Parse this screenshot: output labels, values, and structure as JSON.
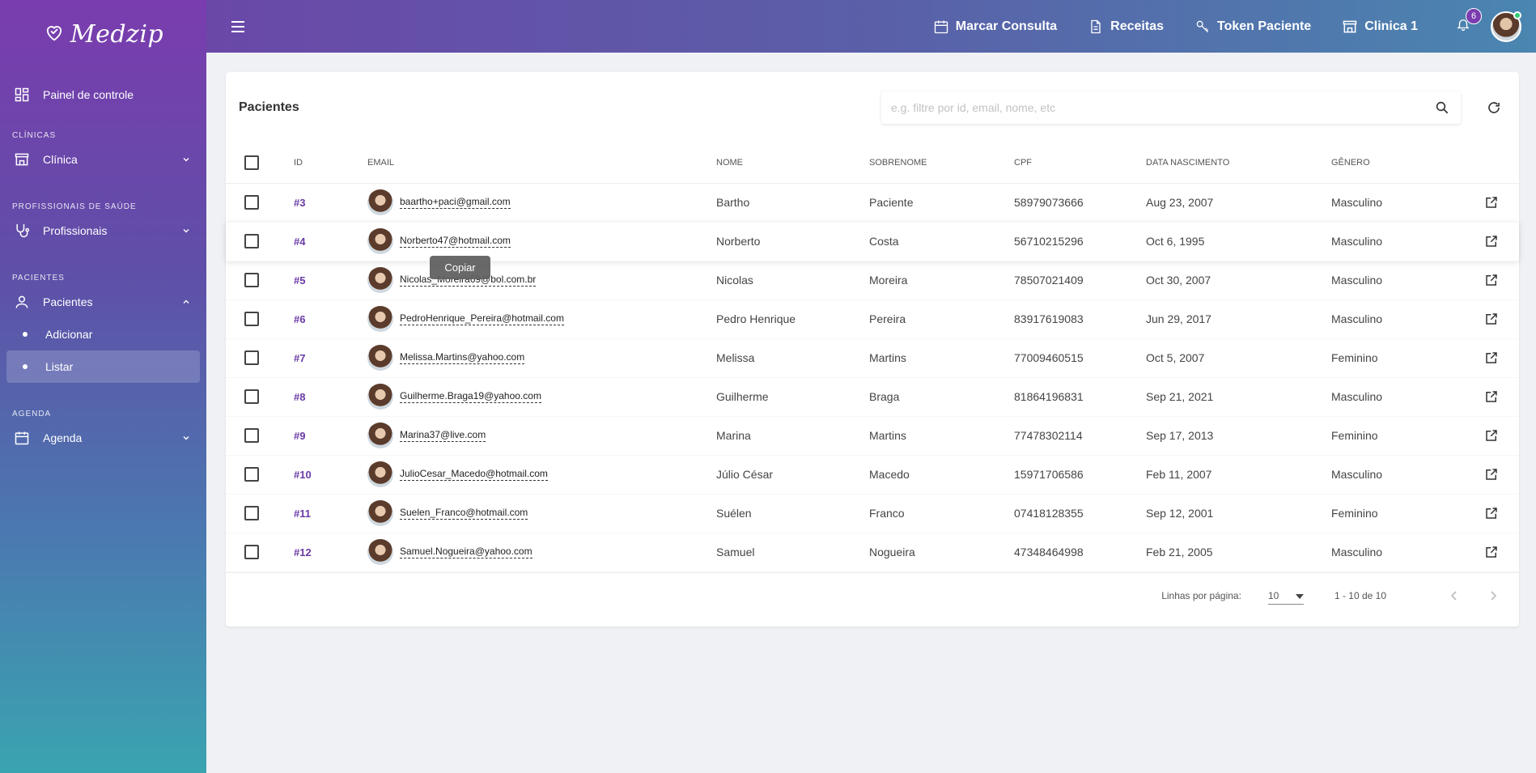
{
  "brand": {
    "name": "Medzip"
  },
  "sidebar": {
    "dashboard": "Painel de controle",
    "sections": {
      "clinicas": "CLÍNICAS",
      "profissionais": "PROFISSIONAIS DE SAÚDE",
      "pacientes": "PACIENTES",
      "agenda": "AGENDA"
    },
    "clinica": "Clínica",
    "profissionais": "Profissionais",
    "pacientes": "Pacientes",
    "pacientes_sub": {
      "adicionar": "Adicionar",
      "listar": "Listar"
    },
    "agenda": "Agenda"
  },
  "topbar": {
    "marcar_consulta": "Marcar Consulta",
    "receitas": "Receitas",
    "token_paciente": "Token Paciente",
    "clinica": "Clinica 1",
    "notifications": "6"
  },
  "page": {
    "title": "Pacientes",
    "search_placeholder": "e.g. filtre por id, email, nome, etc",
    "tooltip": "Copiar"
  },
  "table": {
    "headers": {
      "id": "ID",
      "email": "EMAIL",
      "nome": "NOME",
      "sobrenome": "SOBRENOME",
      "cpf": "CPF",
      "nascimento": "DATA NASCIMENTO",
      "genero": "GÊNERO"
    },
    "rows": [
      {
        "id": "#3",
        "email": "baartho+paci@gmail.com",
        "nome": "Bartho",
        "sobrenome": "Paciente",
        "cpf": "58979073666",
        "nascimento": "Aug 23, 2007",
        "genero": "Masculino"
      },
      {
        "id": "#4",
        "email": "Norberto47@hotmail.com",
        "nome": "Norberto",
        "sobrenome": "Costa",
        "cpf": "56710215296",
        "nascimento": "Oct 6, 1995",
        "genero": "Masculino"
      },
      {
        "id": "#5",
        "email": "Nicolas_Moreira69@bol.com.br",
        "nome": "Nicolas",
        "sobrenome": "Moreira",
        "cpf": "78507021409",
        "nascimento": "Oct 30, 2007",
        "genero": "Masculino"
      },
      {
        "id": "#6",
        "email": "PedroHenrique_Pereira@hotmail.com",
        "nome": "Pedro Henrique",
        "sobrenome": "Pereira",
        "cpf": "83917619083",
        "nascimento": "Jun 29, 2017",
        "genero": "Masculino"
      },
      {
        "id": "#7",
        "email": "Melissa.Martins@yahoo.com",
        "nome": "Melissa",
        "sobrenome": "Martins",
        "cpf": "77009460515",
        "nascimento": "Oct 5, 2007",
        "genero": "Feminino"
      },
      {
        "id": "#8",
        "email": "Guilherme.Braga19@yahoo.com",
        "nome": "Guilherme",
        "sobrenome": "Braga",
        "cpf": "81864196831",
        "nascimento": "Sep 21, 2021",
        "genero": "Masculino"
      },
      {
        "id": "#9",
        "email": "Marina37@live.com",
        "nome": "Marina",
        "sobrenome": "Martins",
        "cpf": "77478302114",
        "nascimento": "Sep 17, 2013",
        "genero": "Feminino"
      },
      {
        "id": "#10",
        "email": "JulioCesar_Macedo@hotmail.com",
        "nome": "Júlio César",
        "sobrenome": "Macedo",
        "cpf": "15971706586",
        "nascimento": "Feb 11, 2007",
        "genero": "Masculino"
      },
      {
        "id": "#11",
        "email": "Suelen_Franco@hotmail.com",
        "nome": "Suélen",
        "sobrenome": "Franco",
        "cpf": "07418128355",
        "nascimento": "Sep 12, 2001",
        "genero": "Feminino"
      },
      {
        "id": "#12",
        "email": "Samuel.Nogueira@yahoo.com",
        "nome": "Samuel",
        "sobrenome": "Nogueira",
        "cpf": "47348464998",
        "nascimento": "Feb 21, 2005",
        "genero": "Masculino"
      }
    ]
  },
  "pager": {
    "rows_label": "Linhas por página:",
    "rows_value": "10",
    "range": "1 - 10 de 10"
  }
}
